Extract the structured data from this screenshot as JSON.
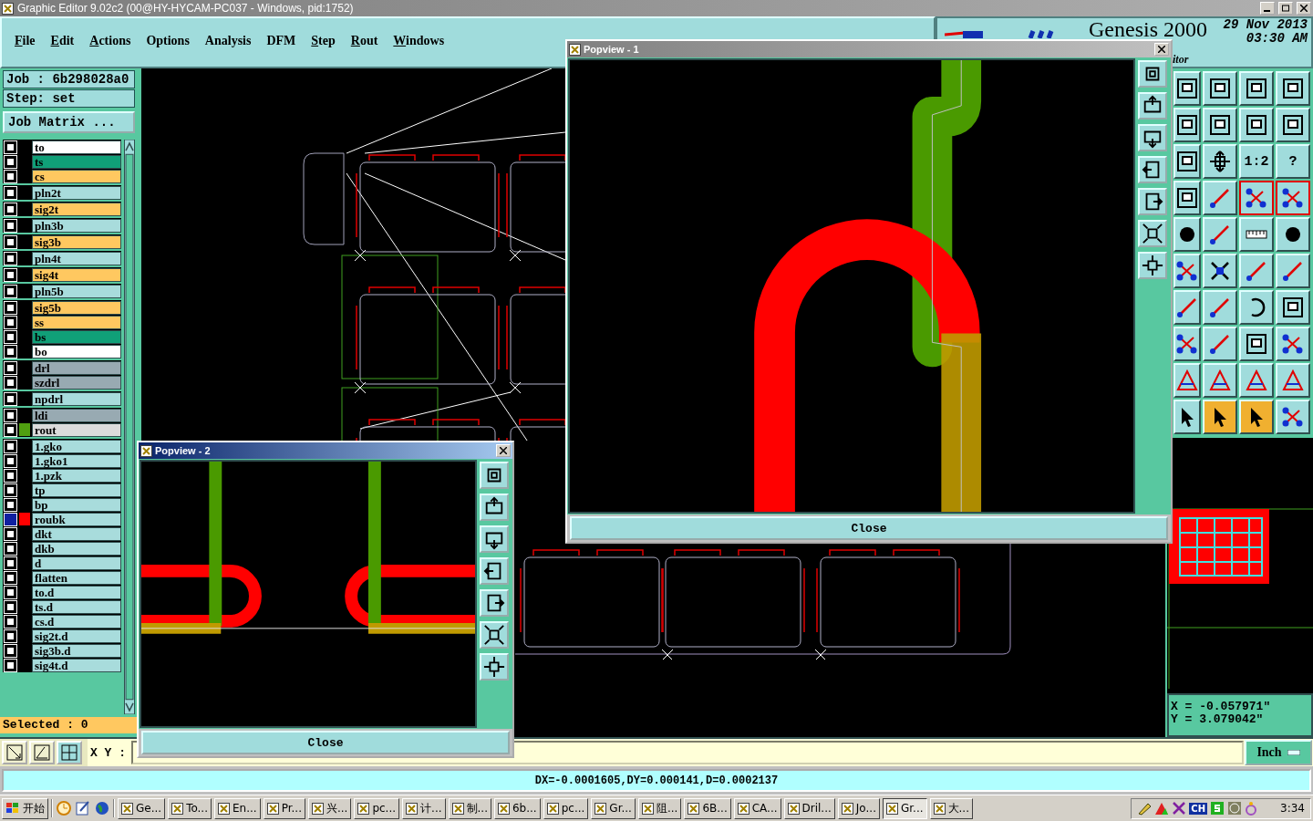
{
  "window": {
    "title": "Graphic Editor 9.02c2 (00@HY-HYCAM-PC037 - Windows, pid:1752)"
  },
  "menu": [
    {
      "label": "File",
      "mnemonic": true
    },
    {
      "label": "Edit",
      "mnemonic": true
    },
    {
      "label": "Actions",
      "mnemonic": true
    },
    {
      "label": "Options",
      "mnemonic": false
    },
    {
      "label": "Analysis",
      "mnemonic": false
    },
    {
      "label": "DFM",
      "mnemonic": false
    },
    {
      "label": "Step",
      "mnemonic": true
    },
    {
      "label": "Rout",
      "mnemonic": true
    },
    {
      "label": "Windows",
      "mnemonic": true
    }
  ],
  "header": {
    "product": "Genesis 2000",
    "date": "29 Nov 2013",
    "time": "03:30 AM",
    "subtitle": "itor"
  },
  "job": {
    "job": "Job :  6b298028a0",
    "step": "Step: set",
    "matrix_button": "Job Matrix ..."
  },
  "layer_groups": [
    [
      {
        "name": "to",
        "color": "#ffffff",
        "selected": false
      },
      {
        "name": "ts",
        "color": "#10a078",
        "selected": false
      },
      {
        "name": "cs",
        "color": "#ffc860",
        "selected": false
      }
    ],
    [
      {
        "name": "pln2t",
        "color": "#a8dcdc",
        "selected": false
      }
    ],
    [
      {
        "name": "sig2t",
        "color": "#ffc860",
        "selected": false
      }
    ],
    [
      {
        "name": "pln3b",
        "color": "#a8dcdc",
        "selected": false
      }
    ],
    [
      {
        "name": "sig3b",
        "color": "#ffc860",
        "selected": false
      }
    ],
    [
      {
        "name": "pln4t",
        "color": "#a8dcdc",
        "selected": false
      }
    ],
    [
      {
        "name": "sig4t",
        "color": "#ffc860",
        "selected": false
      }
    ],
    [
      {
        "name": "pln5b",
        "color": "#a8dcdc",
        "selected": false
      }
    ],
    [
      {
        "name": "sig5b",
        "color": "#ffc860",
        "selected": false
      },
      {
        "name": "ss",
        "color": "#ffc860",
        "selected": false
      },
      {
        "name": "bs",
        "color": "#10a078",
        "selected": false
      },
      {
        "name": "bo",
        "color": "#ffffff",
        "selected": false
      }
    ],
    [
      {
        "name": "drl",
        "color": "#98aab2",
        "selected": false
      },
      {
        "name": "szdrl",
        "color": "#98aab2",
        "selected": false
      }
    ],
    [
      {
        "name": "npdrl",
        "color": "#a8dcdc",
        "selected": false
      }
    ],
    [
      {
        "name": "ldi",
        "color": "#98aab2",
        "selected": false
      },
      {
        "name": "rout",
        "color": "#dcdcdc",
        "selected": false,
        "marker": {
          "color": "#50a010"
        }
      }
    ],
    [
      {
        "name": "1.gko",
        "color": "#a8dcdc",
        "selected": false
      },
      {
        "name": "1.gko1",
        "color": "#a8dcdc",
        "selected": false
      },
      {
        "name": "1.pzk",
        "color": "#a8dcdc",
        "selected": false
      },
      {
        "name": "tp",
        "color": "#a8dcdc",
        "selected": false
      },
      {
        "name": "bp",
        "color": "#a8dcdc",
        "selected": false
      },
      {
        "name": "roubk",
        "color": "#a8dcdc",
        "selected": true,
        "marker": {
          "color": "#ff0000"
        }
      },
      {
        "name": "dkt",
        "color": "#a8dcdc",
        "selected": false
      },
      {
        "name": "dkb",
        "color": "#a8dcdc",
        "selected": false
      },
      {
        "name": "d",
        "color": "#a8dcdc",
        "selected": false
      },
      {
        "name": "flatten",
        "color": "#a8dcdc",
        "selected": false
      },
      {
        "name": "to.d",
        "color": "#a8dcdc",
        "selected": false
      },
      {
        "name": "ts.d",
        "color": "#a8dcdc",
        "selected": false
      },
      {
        "name": "cs.d",
        "color": "#a8dcdc",
        "selected": false
      },
      {
        "name": "sig2t.d",
        "color": "#a8dcdc",
        "selected": false
      },
      {
        "name": "sig3b.d",
        "color": "#a8dcdc",
        "selected": false
      },
      {
        "name": "sig4t.d",
        "color": "#a8dcdc",
        "selected": false
      }
    ]
  ],
  "selected_count": "Selected : 0",
  "tools": [
    {
      "kind": "frame",
      "active": false
    },
    {
      "kind": "frame",
      "active": false
    },
    {
      "kind": "frame",
      "active": false
    },
    {
      "kind": "frame",
      "active": false
    },
    {
      "kind": "frame",
      "active": false
    },
    {
      "kind": "frame",
      "active": false
    },
    {
      "kind": "frame",
      "active": false
    },
    {
      "kind": "frame",
      "active": false
    },
    {
      "kind": "frame",
      "active": false
    },
    {
      "kind": "move",
      "active": false
    },
    {
      "kind": "text",
      "label": "1:2",
      "active": false
    },
    {
      "kind": "text",
      "label": "?",
      "active": false
    },
    {
      "kind": "frame",
      "active": false
    },
    {
      "kind": "line",
      "active": false
    },
    {
      "kind": "nodes",
      "active": true
    },
    {
      "kind": "nodes",
      "active": true
    },
    {
      "kind": "dot",
      "active": false
    },
    {
      "kind": "line",
      "active": false
    },
    {
      "kind": "ruler",
      "active": false
    },
    {
      "kind": "dot",
      "active": false
    },
    {
      "kind": "nodes",
      "active": false
    },
    {
      "kind": "cross",
      "active": false
    },
    {
      "kind": "line",
      "active": false
    },
    {
      "kind": "line",
      "active": false
    },
    {
      "kind": "line",
      "active": false
    },
    {
      "kind": "line",
      "active": false
    },
    {
      "kind": "arc",
      "active": false
    },
    {
      "kind": "frame",
      "active": false
    },
    {
      "kind": "nodes",
      "active": false
    },
    {
      "kind": "line",
      "active": false
    },
    {
      "kind": "frame",
      "active": false
    },
    {
      "kind": "nodes",
      "active": false
    },
    {
      "kind": "triangle",
      "active": false
    },
    {
      "kind": "triangle",
      "active": false
    },
    {
      "kind": "triangle",
      "active": false
    },
    {
      "kind": "triangle",
      "active": false
    },
    {
      "kind": "pointer",
      "active": false
    },
    {
      "kind": "pointer",
      "active": false,
      "color": "#f0b030"
    },
    {
      "kind": "pointer",
      "active": false,
      "color": "#f0b030"
    },
    {
      "kind": "nodes",
      "active": false
    }
  ],
  "coordinates": {
    "x": "X = -0.057971\"",
    "y": "Y = 3.079042\""
  },
  "popviews": [
    {
      "title": "Popview - 1",
      "active": false,
      "close": "Close"
    },
    {
      "title": "Popview - 2",
      "active": true,
      "close": "Close"
    }
  ],
  "xy_label": "X Y :",
  "units_button": "Inch",
  "status": "DX=-0.0001605,DY=0.000141,D=0.0002137",
  "taskbar": {
    "start": "开始",
    "tasks": [
      {
        "label": "Ge...",
        "selected": false
      },
      {
        "label": "To...",
        "selected": false
      },
      {
        "label": "En...",
        "selected": false
      },
      {
        "label": "Pr...",
        "selected": false
      },
      {
        "label": "兴...",
        "selected": false
      },
      {
        "label": "pc...",
        "selected": false
      },
      {
        "label": "计...",
        "selected": false
      },
      {
        "label": "制...",
        "selected": false
      },
      {
        "label": "6b...",
        "selected": false
      },
      {
        "label": "pc...",
        "selected": false
      },
      {
        "label": "Gr...",
        "selected": false
      },
      {
        "label": "阻...",
        "selected": false
      },
      {
        "label": "6B...",
        "selected": false
      },
      {
        "label": "CA...",
        "selected": false
      },
      {
        "label": "Dril...",
        "selected": false
      },
      {
        "label": "Jo...",
        "selected": false
      },
      {
        "label": "Gr...",
        "selected": true
      },
      {
        "label": "大...",
        "selected": false
      }
    ],
    "language": "CH",
    "clock": "3:34"
  }
}
